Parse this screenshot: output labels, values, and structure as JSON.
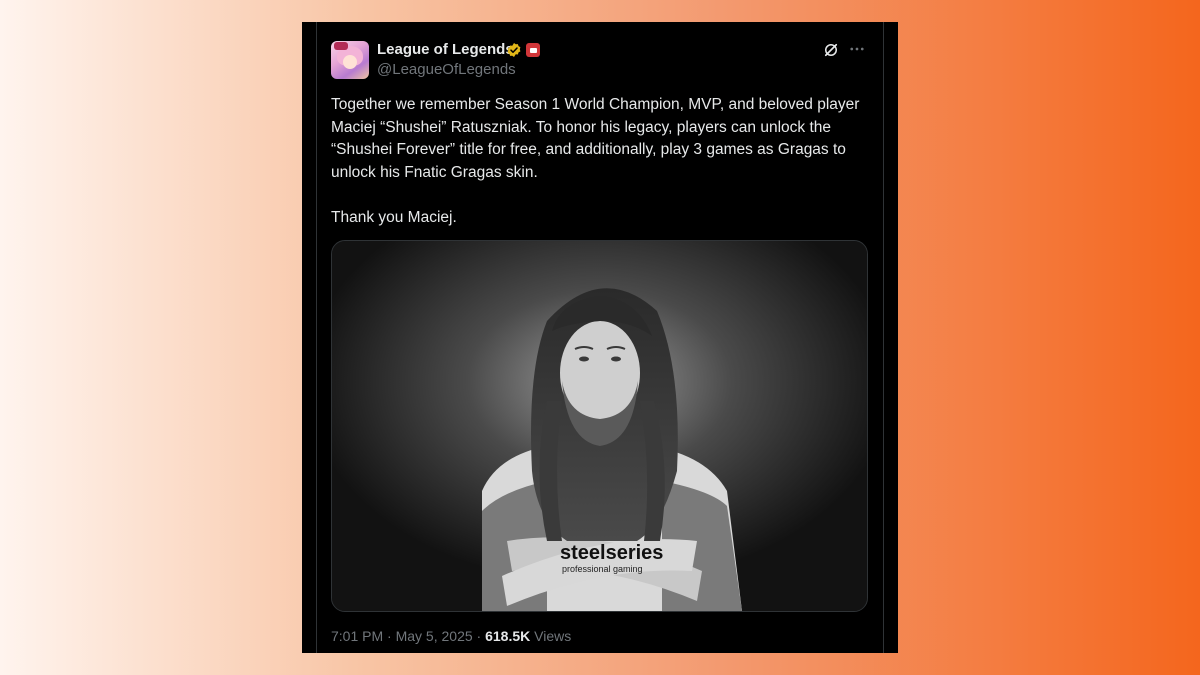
{
  "tweet": {
    "display_name": "League of Legends",
    "handle": "@LeagueOfLegends",
    "text": "Together we remember Season 1 World Champion, MVP, and beloved player Maciej “Shushei” Ratuszniak. To honor his legacy, players can unlock the “Shushei Forever” title for free, and additionally, play 3 games as Gragas to unlock his Fnatic Gragas skin.\n\nThank you Maciej.",
    "time": "7:01 PM",
    "separator": "·",
    "date": "May 5, 2025",
    "views_count": "618.5K",
    "views_label": "Views",
    "jersey_text": "steelseries",
    "jersey_subtext": "professional gaming"
  },
  "icons": {
    "verified": "verified-gold-badge-icon",
    "affiliate": "affiliate-badge-icon",
    "grok": "grok-icon",
    "more": "more-icon"
  },
  "colors": {
    "background_left": "#fff4ee",
    "background_right": "#f4661d",
    "card": "#000000",
    "text_primary": "#e7e9ea",
    "text_secondary": "#71767b",
    "verified_gold": "#e2b719",
    "affiliate_red": "#d13639"
  }
}
